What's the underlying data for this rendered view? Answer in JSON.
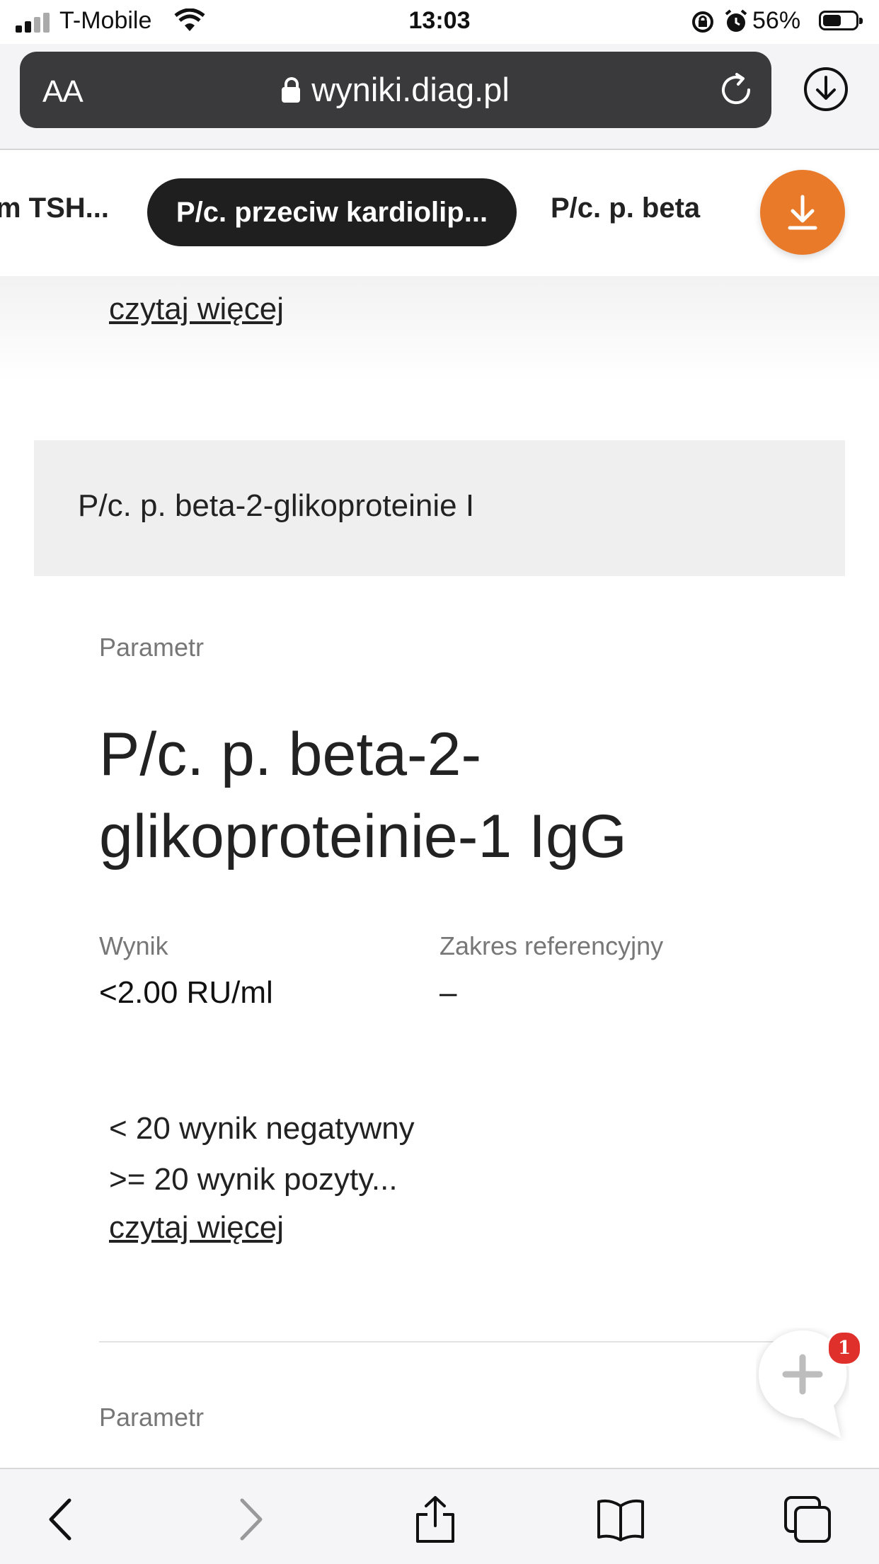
{
  "status_bar": {
    "carrier": "T-Mobile",
    "time": "13:03",
    "battery": "56%",
    "battery_level": 0.56
  },
  "browser": {
    "text_size_label": "AA",
    "url": "wyniki.diag.pl"
  },
  "tabs": {
    "prev": "m TSH...",
    "active": "P/c. przeciw kardiolip...",
    "next": "P/c. p. beta"
  },
  "content": {
    "read_more_1": "czytaj więcej",
    "section_title": "P/c. p. beta-2-glikoproteinie I",
    "param_label": "Parametr",
    "param_title": "P/c. p. beta-2-glikoproteinie-1 IgG",
    "result_label": "Wynik",
    "result_value": "<2.00 RU/ml",
    "range_label": "Zakres referencyjny",
    "range_value": "–",
    "note_line1": "< 20 wynik negatywny",
    "note_line2": ">= 20 wynik pozyty...",
    "read_more_2": "czytaj więcej",
    "param_label_2": "Parametr"
  },
  "chat": {
    "badge_count": "1"
  },
  "icons": [
    "signal-icon",
    "wifi-icon",
    "lock-rotation-icon",
    "alarm-icon",
    "battery-icon",
    "lock-icon",
    "reload-icon",
    "download-circle-icon",
    "download-icon",
    "chat-plus-icon",
    "back-icon",
    "forward-icon",
    "share-icon",
    "bookmarks-icon",
    "tabs-icon"
  ],
  "colors": {
    "accent_orange": "#e87a2a",
    "pill_dark": "#1f1f1f",
    "badge_red": "#e0302c"
  }
}
